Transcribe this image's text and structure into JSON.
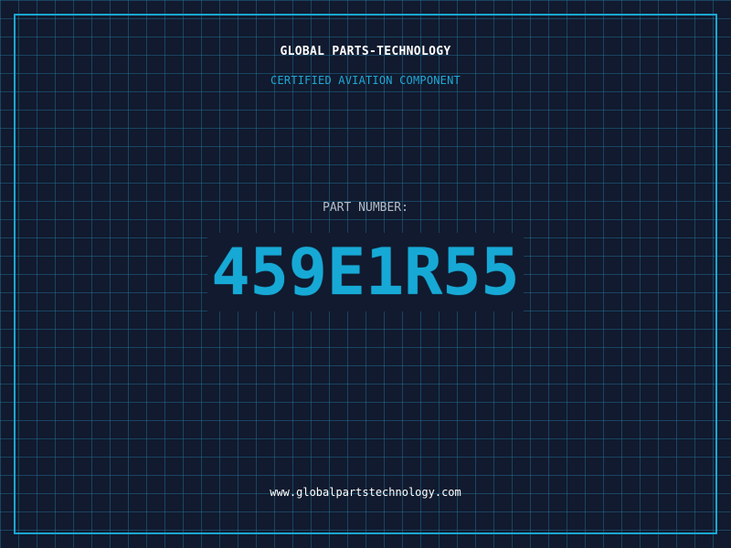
{
  "header": {
    "company_name": "GLOBAL PARTS-TECHNOLOGY",
    "tagline": "CERTIFIED AVIATION COMPONENT"
  },
  "part": {
    "label": "PART NUMBER:",
    "number": "459E1R55"
  },
  "footer": {
    "url": "www.globalpartstechnology.com"
  },
  "colors": {
    "background": "#111a2e",
    "grid": "#1f6f94",
    "accent": "#17a9d6",
    "text_primary": "#ffffff",
    "text_muted": "#b2bdc9"
  }
}
